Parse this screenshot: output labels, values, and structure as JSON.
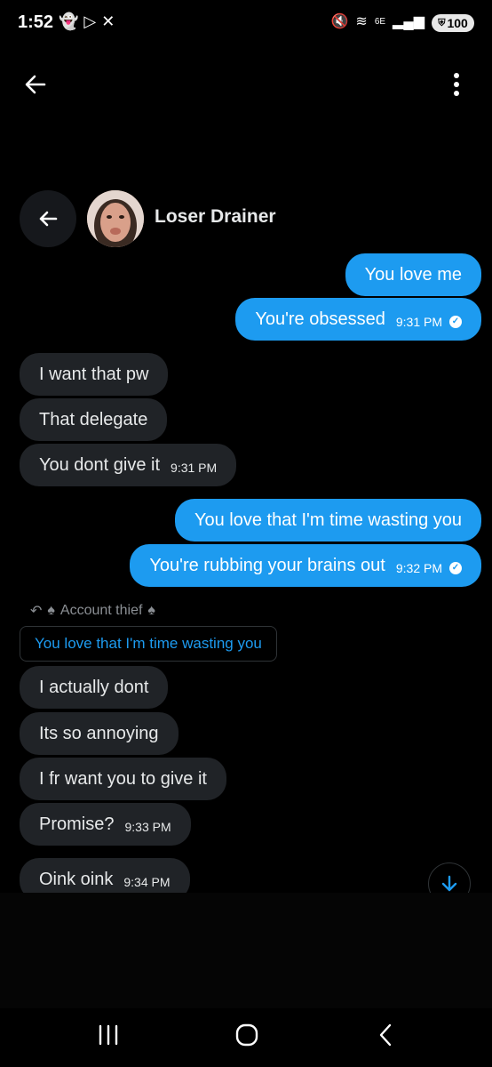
{
  "status_bar": {
    "time": "1:52",
    "network": "6E",
    "battery": "100"
  },
  "header": {
    "contact_name": "Loser Drainer"
  },
  "messages": [
    {
      "dir": "out",
      "text": "You love me",
      "time": ""
    },
    {
      "dir": "out",
      "text": "You're obsessed",
      "time": "9:31 PM",
      "read": true
    },
    {
      "dir": "in",
      "text": "I want that pw",
      "time": ""
    },
    {
      "dir": "in",
      "text": "That delegate",
      "time": ""
    },
    {
      "dir": "in",
      "text": "You dont give it",
      "time": "9:31 PM"
    },
    {
      "dir": "out",
      "text": "You love that I'm time wasting you",
      "time": ""
    },
    {
      "dir": "out",
      "text": "You're rubbing your brains out",
      "time": "9:32 PM",
      "read": true
    },
    {
      "dir": "in",
      "text": "I actually dont",
      "time": ""
    },
    {
      "dir": "in",
      "text": "Its so annoying",
      "time": ""
    },
    {
      "dir": "in",
      "text": "I fr want you to give it",
      "time": ""
    },
    {
      "dir": "in",
      "text": "Promise?",
      "time": "9:33 PM"
    },
    {
      "dir": "in",
      "text": "Oink oink",
      "time": "9:34 PM"
    }
  ],
  "reply_context": {
    "author": "Account thief",
    "quoted": "You love that I'm time wasting you"
  },
  "icons": {
    "back": "arrow-left-icon",
    "more": "vertical-dots-icon",
    "scroll": "arrow-down-icon"
  }
}
